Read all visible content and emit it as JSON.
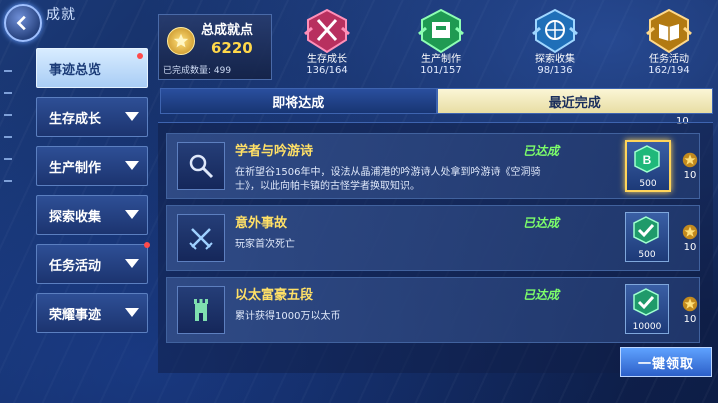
{
  "header": {
    "title": "成就"
  },
  "sidebar": {
    "items": [
      {
        "label": "事迹总览",
        "active": true,
        "dot": true
      },
      {
        "label": "生存成长",
        "active": false,
        "dot": false
      },
      {
        "label": "生产制作",
        "active": false,
        "dot": false
      },
      {
        "label": "探索收集",
        "active": false,
        "dot": false
      },
      {
        "label": "任务活动",
        "active": false,
        "dot": true
      },
      {
        "label": "荣耀事迹",
        "active": false,
        "dot": false
      }
    ]
  },
  "summary": {
    "label": "总成就点",
    "points": "6220",
    "completed": "已完成数量: 499"
  },
  "categories": [
    {
      "name": "生存成长",
      "count": "136/164",
      "color": "#d8457f"
    },
    {
      "name": "生产制作",
      "count": "101/157",
      "color": "#37c46a"
    },
    {
      "name": "探索收集",
      "count": "98/136",
      "color": "#3ea4e8"
    },
    {
      "name": "任务活动",
      "count": "162/194",
      "color": "#e0a32a"
    }
  ],
  "tabs": {
    "left": "即将达成",
    "right": "最近完成"
  },
  "list": {
    "top_points": "10",
    "rows": [
      {
        "name": "学者与吟游诗",
        "status": "已达成",
        "desc": "在祈望谷1506年中，设法从晶浦港的吟游诗人处拿到吟游诗《空洞骑士》，以此向帕卡镇的古怪学者换取知识。",
        "reward": "500",
        "points": "10",
        "icon": "magnifier-icon",
        "reward_icon": "b-token-icon"
      },
      {
        "name": "意外事故",
        "status": "已达成",
        "desc": "玩家首次死亡",
        "reward": "500",
        "points": "10",
        "icon": "crossed-swords-icon",
        "reward_icon": "check-token-icon"
      },
      {
        "name": "以太富豪五段",
        "status": "已达成",
        "desc": "累计获得1000万以太币",
        "reward": "10000",
        "points": "10",
        "icon": "tower-icon",
        "reward_icon": "check-token-icon"
      }
    ]
  },
  "claim_button": "一键领取"
}
